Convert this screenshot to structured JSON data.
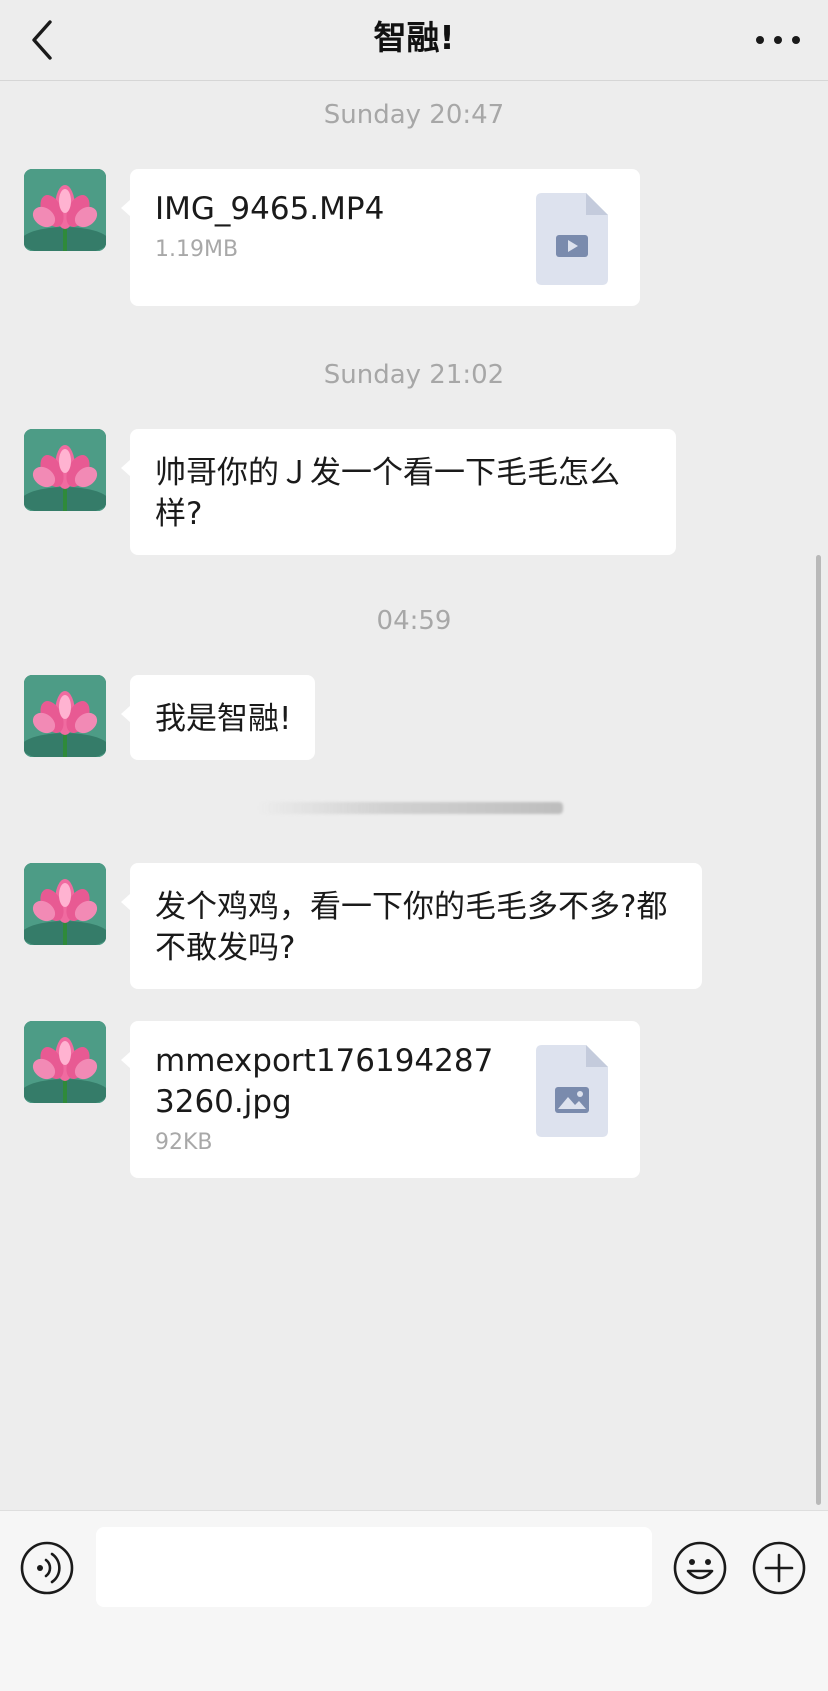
{
  "header": {
    "title": "智融!",
    "back_icon": "chevron-left-icon",
    "more_icon": "more-horizontal-icon"
  },
  "timestamps": [
    "Sunday 20:47",
    "Sunday 21:02",
    "04:59"
  ],
  "messages": [
    {
      "type": "file",
      "file_name": "IMG_9465.MP4",
      "file_size": "1.19MB",
      "icon": "video-file-icon"
    },
    {
      "type": "text",
      "text": "帅哥你的Ｊ发一个看一下毛毛怎么样?"
    },
    {
      "type": "text",
      "text": "我是智融!"
    },
    {
      "type": "text",
      "text": "发个鸡鸡，看一下你的毛毛多不多?都不敢发吗?"
    },
    {
      "type": "file",
      "file_name": "mmexport1761942873260.jpg",
      "file_size": "92KB",
      "icon": "image-file-icon"
    }
  ],
  "input_bar": {
    "voice_icon": "voice-icon",
    "emoji_icon": "emoji-icon",
    "plus_icon": "plus-icon",
    "value": ""
  },
  "colors": {
    "background": "#ededed",
    "bubble": "#ffffff",
    "timestamp": "#a7a7a7",
    "file_icon": "#dde2ee"
  }
}
